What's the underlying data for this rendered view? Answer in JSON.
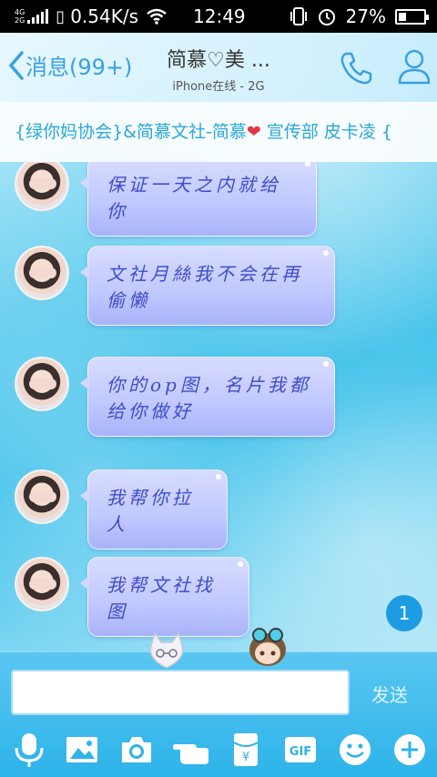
{
  "status_bar": {
    "network_top": "4G",
    "network_bottom": "2G",
    "speed": "0.54K/s",
    "time": "12:49",
    "battery": "27%"
  },
  "header": {
    "back_label": "消息(99+)",
    "title": "简慕♡美 ...",
    "subtitle": "iPhone在线 - 2G"
  },
  "group_bar": {
    "text_before": "{绿你妈协会}&简慕文社-简慕",
    "text_after": " 宣传部 皮卡凌 {"
  },
  "messages": [
    {
      "text": "保证一天之内就给你"
    },
    {
      "text": "文社月絲我不会在再偷懒"
    },
    {
      "text": "你的op图，名片我都给你做好"
    },
    {
      "text": "我帮你拉人"
    },
    {
      "text": "我帮文社找图"
    }
  ],
  "unread_badge": "1",
  "input": {
    "value": "",
    "send_label": "发送"
  },
  "toolbar": {
    "icons": [
      "microphone-icon",
      "image-icon",
      "camera-icon",
      "poke-icon",
      "red-packet-icon",
      "gif-icon",
      "emoji-icon",
      "plus-icon"
    ],
    "gif_label": "GIF"
  },
  "colors": {
    "accent": "#3b9fe2",
    "bubble_text": "#3f4cc8",
    "input_bar": "#2db3e9",
    "badge": "#1e9ce3"
  }
}
